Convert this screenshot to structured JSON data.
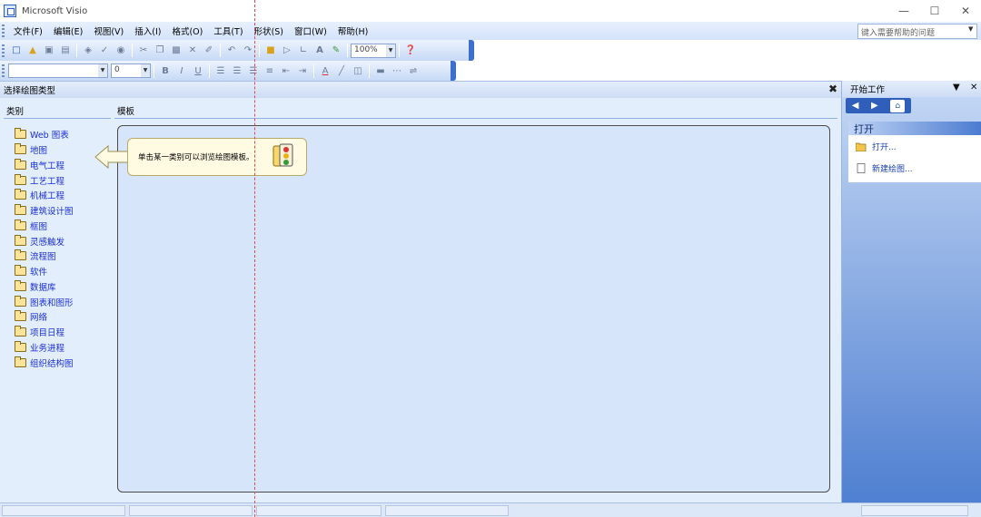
{
  "window": {
    "title": "Microsoft Visio"
  },
  "menu": {
    "items": [
      "文件(F)",
      "编辑(E)",
      "视图(V)",
      "插入(I)",
      "格式(O)",
      "工具(T)",
      "形状(S)",
      "窗口(W)",
      "帮助(H)"
    ]
  },
  "help_box": {
    "placeholder": "键入需要帮助的问题"
  },
  "toolbar": {
    "zoom": "100%",
    "font_size": "0",
    "font_name": ""
  },
  "left_pane": {
    "title": "选择绘图类型",
    "category_header": "类别",
    "template_header": "模板",
    "categories": [
      "Web 图表",
      "地图",
      "电气工程",
      "工艺工程",
      "机械工程",
      "建筑设计图",
      "框图",
      "灵感触发",
      "流程图",
      "软件",
      "数据库",
      "图表和图形",
      "网络",
      "项目日程",
      "业务进程",
      "组织结构图"
    ],
    "callout_text": "单击某一类别可以浏览绘图模板。"
  },
  "task_pane": {
    "title": "开始工作",
    "section_title": "打开",
    "links": [
      "打开...",
      "新建绘图..."
    ]
  },
  "colors": {
    "accent": "#2f5fba",
    "link": "#1a2fd6",
    "guide_line": "#e24a4a"
  }
}
